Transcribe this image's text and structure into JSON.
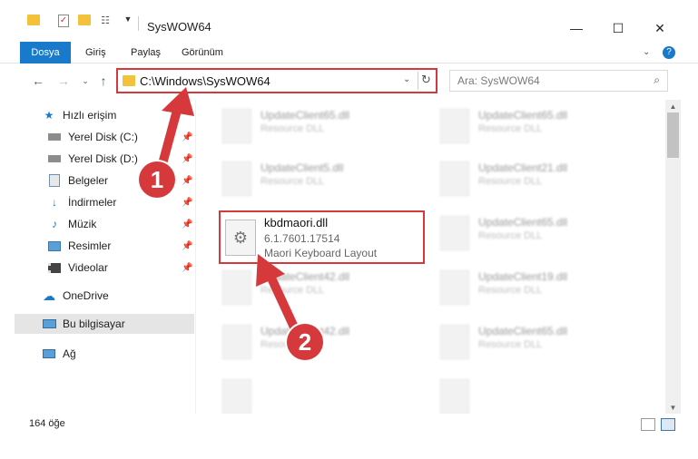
{
  "window": {
    "title": "SysWOW64",
    "min": "—",
    "max": "☐",
    "close": "✕"
  },
  "ribbon": {
    "tabs": [
      "Dosya",
      "Giriş",
      "Paylaş",
      "Görünüm"
    ]
  },
  "address": {
    "path": "C:\\Windows\\SysWOW64",
    "search_placeholder": "Ara: SysWOW64"
  },
  "sidebar": {
    "items": [
      {
        "label": "Hızlı erişim",
        "icon": "star-icon"
      },
      {
        "label": "Yerel Disk (C:)",
        "icon": "disk-icon"
      },
      {
        "label": "Yerel Disk (D:)",
        "icon": "disk-icon"
      },
      {
        "label": "Belgeler",
        "icon": "documents-icon"
      },
      {
        "label": "İndirmeler",
        "icon": "download-icon"
      },
      {
        "label": "Müzik",
        "icon": "music-icon"
      },
      {
        "label": "Resimler",
        "icon": "pictures-icon"
      },
      {
        "label": "Videolar",
        "icon": "video-icon"
      },
      {
        "label": "OneDrive",
        "icon": "cloud-icon"
      },
      {
        "label": "Bu bilgisayar",
        "icon": "computer-icon"
      },
      {
        "label": "Ağ",
        "icon": "network-icon"
      }
    ]
  },
  "files": [
    {
      "name": "UpdateClient65.dll",
      "type": "Resource DLL"
    },
    {
      "name": "UpdateClient65.dll",
      "type": "Resource DLL"
    },
    {
      "name": "UpdateClient5.dll",
      "type": "Resource DLL"
    },
    {
      "name": "UpdateClient21.dll",
      "type": "Resource DLL"
    },
    {
      "name": "UpdateClient65.dll",
      "type": "Resource DLL"
    },
    {
      "name": "UpdateClient42.dll",
      "type": "Resource DLL"
    },
    {
      "name": "UpdateClient19.dll",
      "type": "Resource DLL"
    },
    {
      "name": "UpdateClient42.dll",
      "type": "Resource DLL"
    },
    {
      "name": "UpdateClient65.dll",
      "type": "Resource DLL"
    }
  ],
  "highlighted_file": {
    "name": "kbdmaori.dll",
    "version": "6.1.7601.17514",
    "description": "Maori Keyboard Layout"
  },
  "status": {
    "count": "164 öğe"
  },
  "annotations": {
    "step1": "1",
    "step2": "2",
    "color": "#d6393b"
  }
}
